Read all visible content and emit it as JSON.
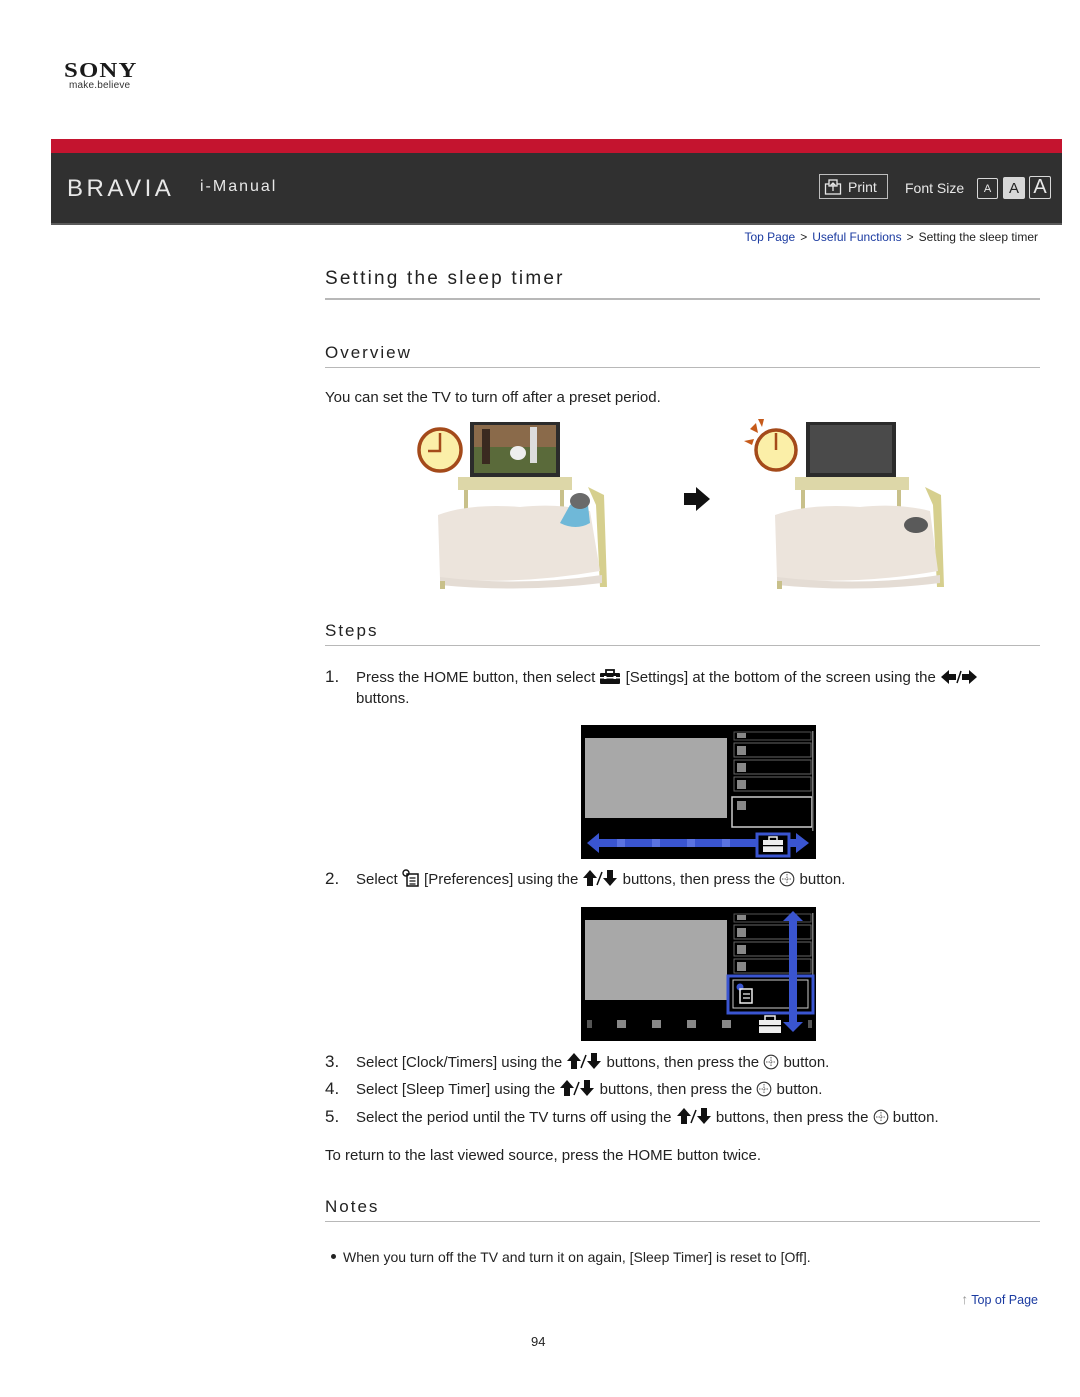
{
  "brand": {
    "logo": "SONY",
    "tagline": "make.believe"
  },
  "header": {
    "product": "BRAVIA",
    "title": "i-Manual",
    "print_label": "Print",
    "font_size_label": "Font Size",
    "font_size_options": [
      "A",
      "A",
      "A"
    ],
    "font_size_selected": "medium",
    "accent_color": "#c4142f",
    "bar_color": "#303030"
  },
  "breadcrumb": {
    "items": [
      {
        "label": "Top Page",
        "link": true
      },
      {
        "label": "Useful Functions",
        "link": true
      },
      {
        "label": "Setting the sleep timer",
        "link": false
      }
    ],
    "separator": ">"
  },
  "page": {
    "title": "Setting the sleep timer",
    "overview_heading": "Overview",
    "overview_text": "You can set the TV to turn off after a preset period.",
    "steps_heading": "Steps",
    "steps": [
      {
        "number": "1.",
        "parts": [
          "Press the HOME button, then select ",
          "settings-icon",
          " [Settings] at the bottom of the screen using the ",
          "left-right-arrows-icon",
          ""
        ],
        "continuation": "buttons."
      },
      {
        "number": "2.",
        "parts": [
          "Select ",
          "preferences-icon",
          " [Preferences] using the ",
          "up-down-arrows-icon",
          " buttons, then press the ",
          "enter-button-icon",
          " button."
        ]
      },
      {
        "number": "3.",
        "parts": [
          "Select [Clock/Timers] using the ",
          "up-down-arrows-icon",
          " buttons, then press the ",
          "enter-button-icon",
          " button."
        ]
      },
      {
        "number": "4.",
        "parts": [
          "Select [Sleep Timer] using the ",
          "up-down-arrows-icon",
          " buttons, then press the ",
          "enter-button-icon",
          " button."
        ]
      },
      {
        "number": "5.",
        "parts": [
          "Select the period until the TV turns off using the ",
          "up-down-arrows-icon",
          " buttons, then press the ",
          "enter-button-icon",
          " button."
        ]
      }
    ],
    "return_text": "To return to the last viewed source, press the HOME button twice.",
    "notes_heading": "Notes",
    "notes": [
      "When you turn off the TV and turn it on again, [Sleep Timer] is reset to [Off]."
    ],
    "top_of_page": "Top of Page",
    "page_number": "94"
  },
  "colors": {
    "link": "#1a3aa0",
    "highlight_blue": "#3a55d0"
  }
}
